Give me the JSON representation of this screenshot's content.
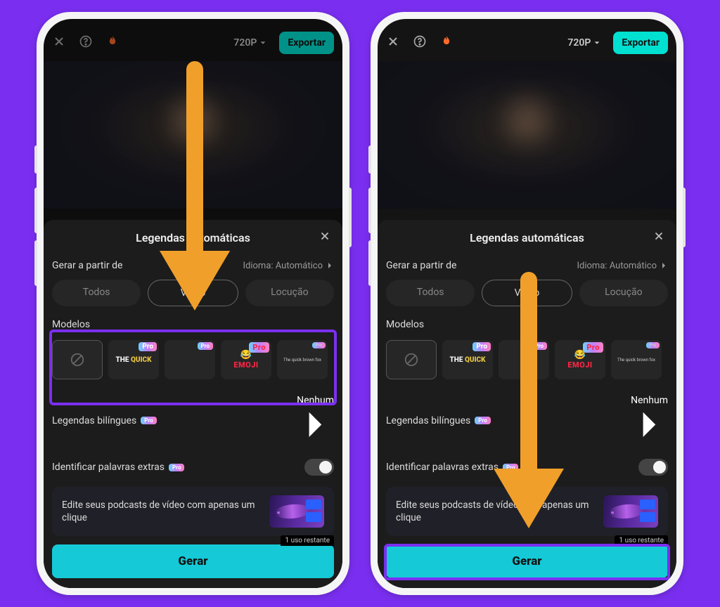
{
  "topbar": {
    "resolution": "720P",
    "export": "Exportar"
  },
  "panel": {
    "title": "Legendas automáticas",
    "generate_from": "Gerar a partir de",
    "language_label": "Idioma: Automático",
    "seg_all": "Todos",
    "seg_video": "Vídeo",
    "seg_voice": "Locução",
    "models": "Modelos",
    "pro": "Pro",
    "template_quick_a": "THE ",
    "template_quick_b": "QUICK",
    "template_emoji": "EMOJI",
    "template_last": "The quick brown fox",
    "bilingual_label": "Legendas bilíngues",
    "bilingual_value": "Nenhum",
    "extras_label": "Identificar palavras extras",
    "promo": "Edite seus podcasts de vídeo com apenas um clique",
    "uses_left": "1 uso restante",
    "generate": "Gerar"
  }
}
